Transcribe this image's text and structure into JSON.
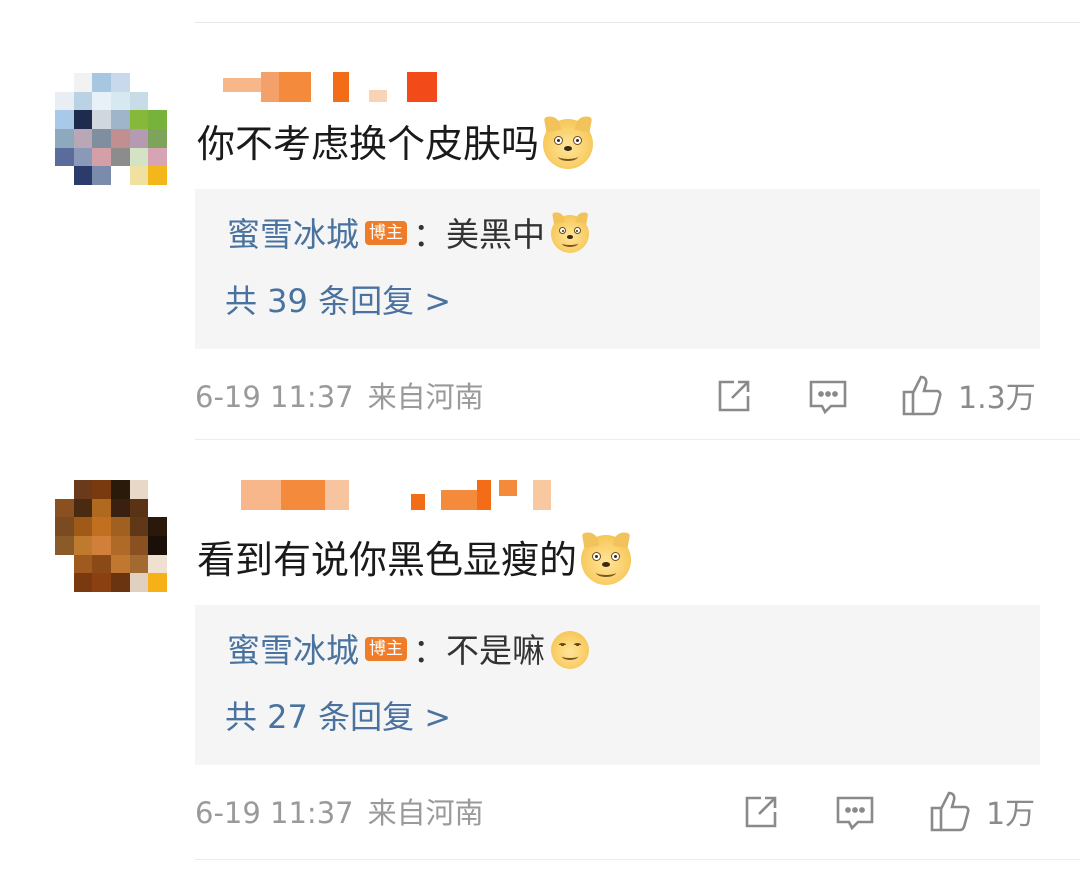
{
  "comments": [
    {
      "text": "你不考虑换个皮肤吗",
      "text_emoji": "doge-emoji",
      "reply": {
        "author": "蜜雪冰城",
        "badge": "博主",
        "text": "：美黑中",
        "emoji": "doge-emoji",
        "more": "共 39 条回复 >"
      },
      "meta": {
        "time": "6-19 11:37",
        "location": "来自河南"
      },
      "likes": "1.3万"
    },
    {
      "text": "看到有说你黑色显瘦的",
      "text_emoji": "doge-emoji",
      "reply": {
        "author": "蜜雪冰城",
        "badge": "博主",
        "text": "：不是嘛",
        "emoji": "smirk-emoji",
        "more": "共 27 条回复 >"
      },
      "meta": {
        "time": "6-19 11:37",
        "location": "来自河南"
      },
      "likes": "1万"
    }
  ],
  "icons": {
    "share": "share-icon",
    "comment": "comment-icon",
    "like": "thumbs-up-icon"
  },
  "colors": {
    "link": "#49729e",
    "badge": "#f07c28",
    "reply_bg": "#f5f5f5",
    "meta": "#9a9a9a"
  }
}
